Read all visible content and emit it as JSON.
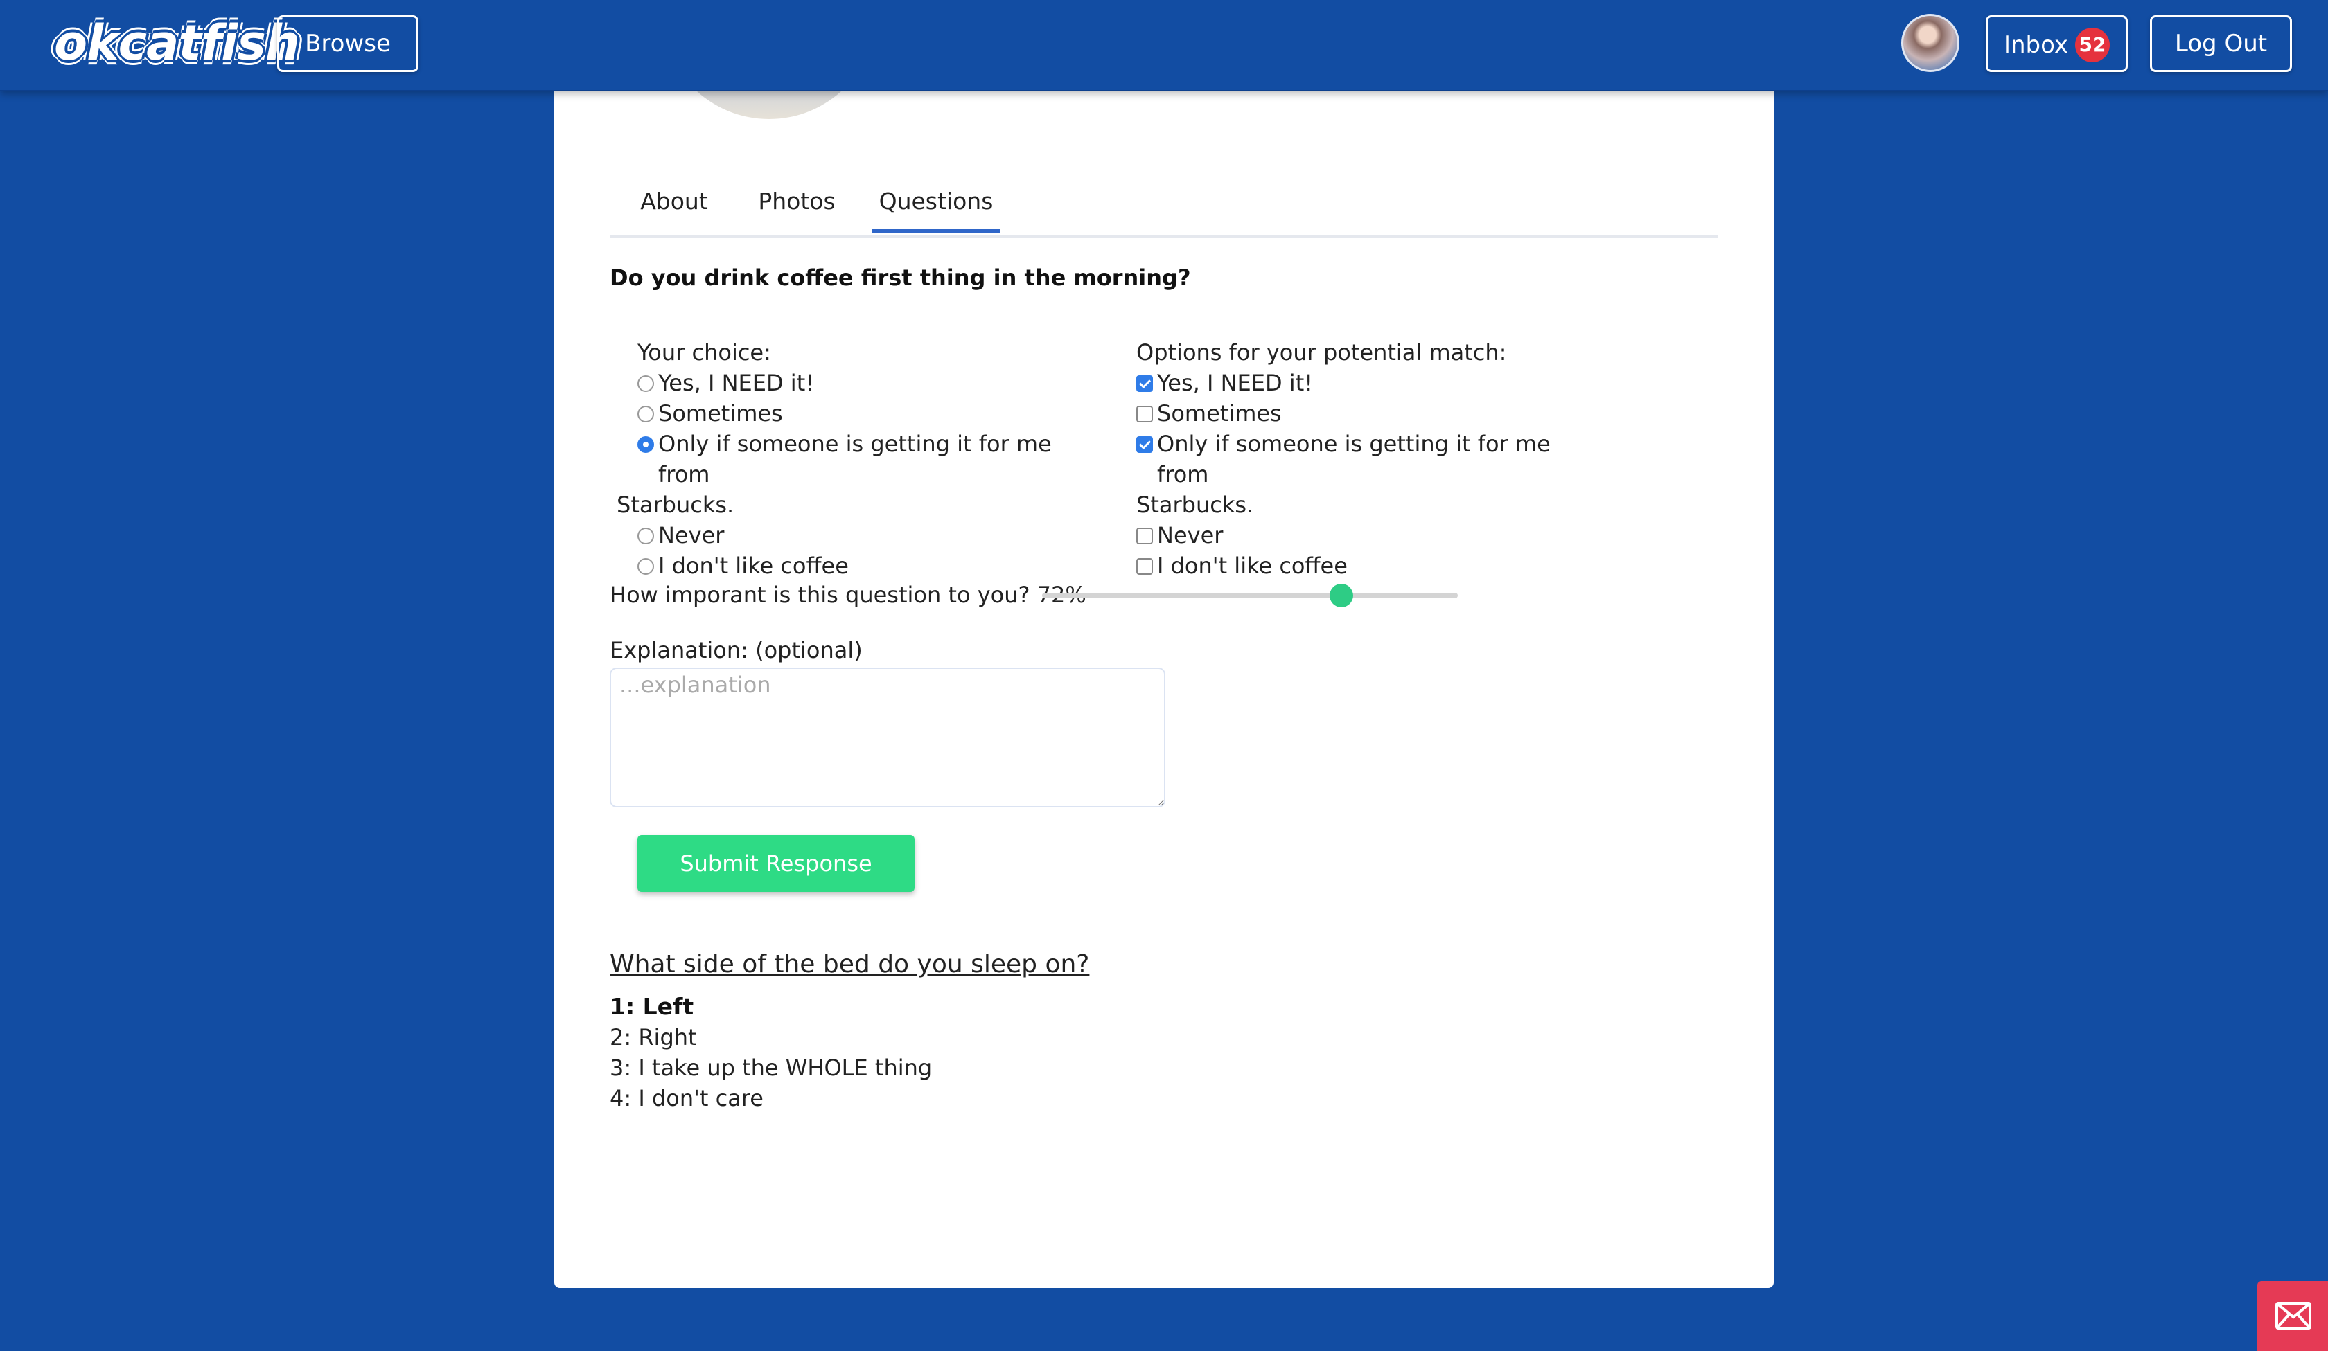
{
  "header": {
    "logo_text": "okcatfish",
    "browse_label": "Browse",
    "inbox_label": "Inbox",
    "inbox_count": "52",
    "logout_label": "Log Out"
  },
  "tabs": [
    {
      "label": "About"
    },
    {
      "label": "Photos"
    },
    {
      "label": "Questions",
      "active": true
    }
  ],
  "question": {
    "title": "Do you drink coffee first thing in the morning?",
    "your_choice_label": "Your choice:",
    "match_label": "Options for your potential match:",
    "options": [
      {
        "label": "Yes, I NEED it!",
        "your_choice": false,
        "match": true
      },
      {
        "label": "Sometimes",
        "your_choice": false,
        "match": false
      },
      {
        "label_line1": "Only if someone is getting it for me from",
        "label_line2": "Starbucks.",
        "your_choice": true,
        "match": true
      },
      {
        "label": "Never",
        "your_choice": false,
        "match": false
      },
      {
        "label": "I don't like coffee",
        "your_choice": false,
        "match": false
      }
    ],
    "importance_text": "How imporant is this question to you? 72%",
    "importance_value": 0.72,
    "explanation_label": "Explanation: (optional)",
    "explanation_placeholder": "...explanation",
    "explanation_value": "",
    "submit_label": "Submit Response"
  },
  "next_question": {
    "title": "What side of the bed do you sleep on?",
    "answers": [
      {
        "text": "1: Left",
        "selected": true
      },
      {
        "text": "2: Right",
        "selected": false
      },
      {
        "text": "3: I take up the WHOLE thing",
        "selected": false
      },
      {
        "text": "4: I don't care",
        "selected": false
      }
    ]
  },
  "colors": {
    "background": "#124da3",
    "accent_green": "#2edb85",
    "badge_red": "#e5323e",
    "mail_button": "#e53a55",
    "tab_active": "#2f66c9"
  },
  "icons": {
    "mail": "envelope-icon"
  }
}
